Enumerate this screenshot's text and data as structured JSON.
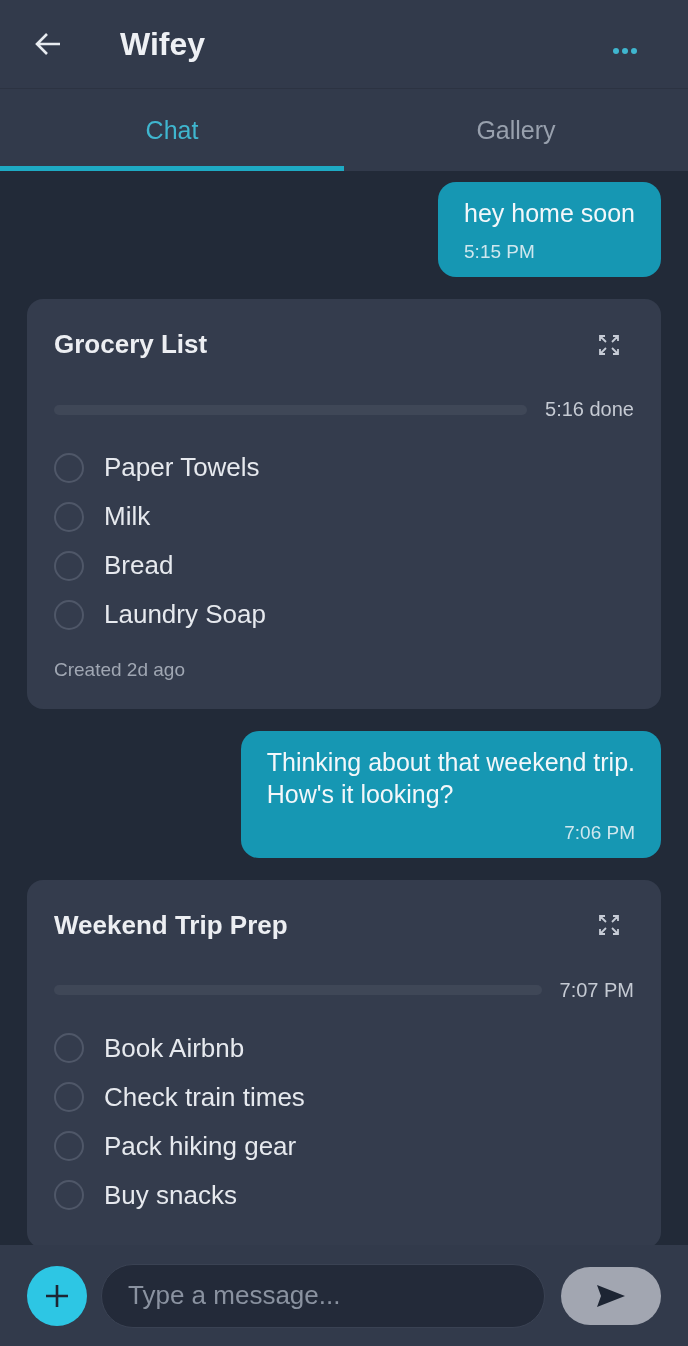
{
  "header": {
    "title": "Wifey"
  },
  "tabs": [
    {
      "label": "Chat",
      "selected": true
    },
    {
      "label": "Gallery",
      "selected": false
    }
  ],
  "messages": [
    {
      "kind": "text",
      "text": "hey home soon",
      "time": "5:15 PM"
    },
    {
      "kind": "checklist",
      "title": "Grocery List",
      "level": 0,
      "status": "5:16 done",
      "items": [
        {
          "label": "Paper Towels",
          "checked": false
        },
        {
          "label": "Milk",
          "checked": false
        },
        {
          "label": "Bread",
          "checked": false
        },
        {
          "label": "Laundry Soap",
          "checked": false
        }
      ],
      "footer": "Created 2d ago"
    },
    {
      "kind": "text",
      "text": "Thinking about that weekend trip.\nHow's it looking?",
      "time": "7:06 PM"
    },
    {
      "kind": "checklist",
      "title": "Weekend Trip Prep",
      "level": 0,
      "status": "7:07 PM",
      "items": [
        {
          "label": "Book Airbnb",
          "checked": false
        },
        {
          "label": "Check train times",
          "checked": false
        },
        {
          "label": "Pack hiking gear",
          "checked": false
        },
        {
          "label": "Buy snacks",
          "checked": false
        }
      ]
    }
  ],
  "composer": {
    "placeholder": "Type a message..."
  }
}
